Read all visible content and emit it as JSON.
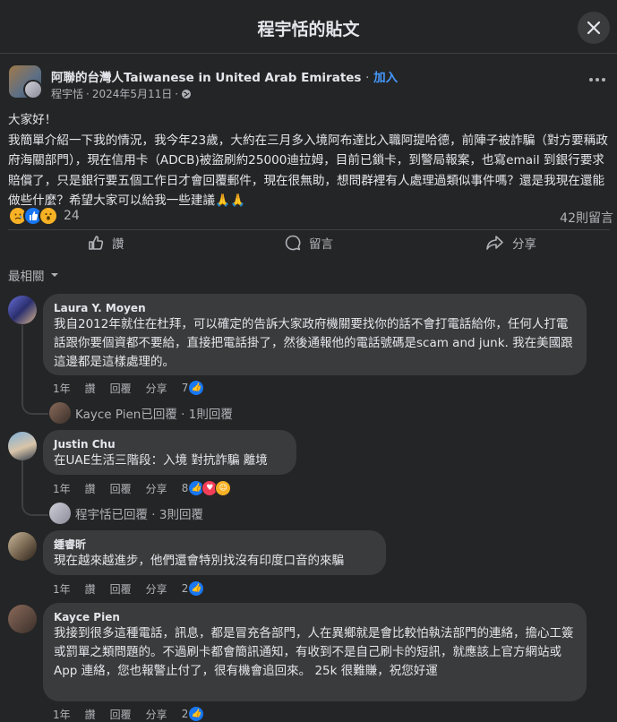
{
  "header": {
    "title": "程宇恬的貼文"
  },
  "post": {
    "group_name": "阿聯的台灣人Taiwanese in United Arab Emirates",
    "separator": "·",
    "join_label": "加入",
    "author": "程宇恬",
    "date": "2024年5月11日",
    "body": [
      "大家好！",
      "我簡單介紹一下我的情況，我今年23歲，大約在三月多入境阿布達比入職阿提哈德，前陣子被詐騙（對方要稱政府海關部門），現在信用卡（ADCB)被盜刷約25000迪拉姆，目前已鎖卡，到警局報案，也寫email 到銀行要求賠償了，只是銀行要五個工作日才會回覆郵件，現在很無助，想問群裡有人處理過類似事件嗎？還是我現在還能做些什麼？希望大家可以給我一些建議🙏🙏"
    ],
    "reaction_count": "24",
    "comment_count": "42則留言",
    "actions": {
      "like": "讚",
      "comment": "留言",
      "share": "分享"
    }
  },
  "sort_label": "最相關",
  "comments": [
    {
      "name": "Laura Y. Moyen",
      "text": "我自2012年就住在杜拜，可以確定的告訴大家政府機關要找你的話不會打電話給你，任何人打電話跟你要個資都不要給，直接把電話掛了，然後通報他的電話號碼是scam and junk. 我在美國跟這邊都是這樣處理的。",
      "time": "1年",
      "like": "讚",
      "reply": "回覆",
      "share": "分享",
      "likes": "7",
      "replies": "Kayce Pien已回覆 · 1則回覆"
    },
    {
      "name": "Justin Chu",
      "text": "在UAE生活三階段：入境 對抗詐騙 離境",
      "time": "1年",
      "like": "讚",
      "reply": "回覆",
      "share": "分享",
      "likes": "8",
      "replies": "程宇恬已回覆 · 3則回覆"
    },
    {
      "name": "鍾睿昕",
      "text": "現在越來越進步，他們還會特別找沒有印度口音的來騙",
      "time": "1年",
      "like": "讚",
      "reply": "回覆",
      "share": "分享",
      "likes": "2"
    },
    {
      "name": "Kayce Pien",
      "text": "我接到很多這種電話，訊息，都是冒充各部門，人在異鄉就是會比較怕執法部門的連絡，擔心工簽或罰單之類問題的。不過刷卡都會簡訊通知，有收到不是自己刷卡的短訊，就應該上官方網站或App 連絡，您也報警止付了，很有機會追回來。 25k 很難賺，祝您好運",
      "time": "1年",
      "like": "讚",
      "reply": "回覆",
      "share": "分享",
      "likes": "2"
    }
  ],
  "colors": {
    "background": "#242526",
    "bubble": "#3a3b3c",
    "accent": "#4599ff",
    "text": "#e4e6eb",
    "muted": "#b0b3b8",
    "like_blue": "#1877f2"
  }
}
